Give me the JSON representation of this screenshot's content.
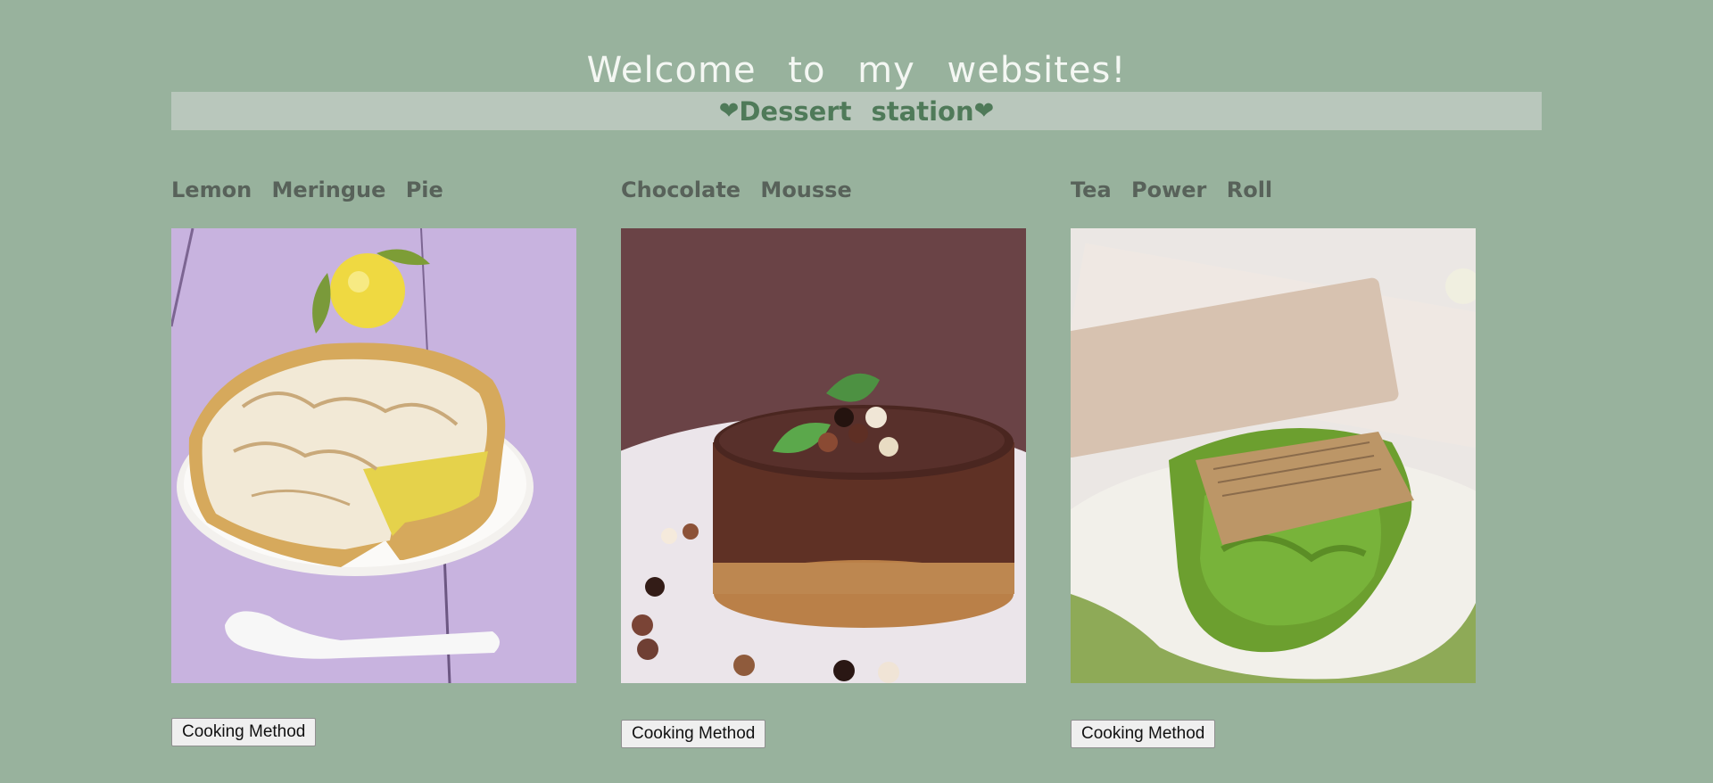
{
  "header": {
    "title": "Welcome to my websites!"
  },
  "banner": {
    "heart_left": "❤",
    "label": "Dessert station",
    "heart_right": "❤"
  },
  "desserts": [
    {
      "name": "Lemon Meringue Pie",
      "image_icon": "lemon-meringue-pie-photo",
      "button_label": "Cooking Method"
    },
    {
      "name": "Chocolate Mousse",
      "image_icon": "chocolate-mousse-photo",
      "button_label": "Cooking Method"
    },
    {
      "name": "Tea Power Roll",
      "image_icon": "matcha-roll-photo",
      "button_label": "Cooking Method"
    }
  ],
  "colors": {
    "page_background": "#98b29d",
    "banner_background": "#b9c7bc",
    "banner_text": "#4f7a59",
    "title_text": "#f4f7f3"
  }
}
